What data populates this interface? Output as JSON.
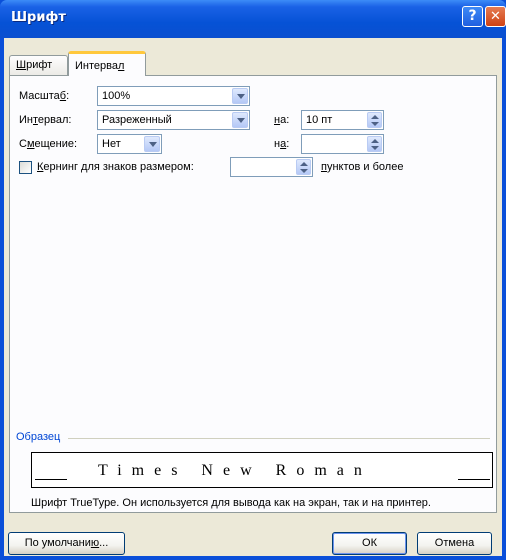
{
  "window": {
    "title": "Шрифт",
    "help_symbol": "?",
    "close_symbol": "✕",
    "icons": {
      "help": "help-icon",
      "close": "close-icon"
    }
  },
  "tabs": [
    {
      "label_u": "Ш",
      "label_rest": "рифт",
      "active": false
    },
    {
      "label_pre": "Интерва",
      "label_u": "л",
      "active": true
    }
  ],
  "spacing": {
    "scale": {
      "label_pre": "Масшта",
      "label_u": "б",
      "label_post": ":",
      "value": "100%"
    },
    "interval": {
      "label_pre": "Ин",
      "label_u": "т",
      "label_post": "ервал:",
      "value": "Разреженный",
      "by_label_u": "н",
      "by_label_post": "а:",
      "by_value": "10 пт"
    },
    "offset": {
      "label_pre": "С",
      "label_u": "м",
      "label_post": "ещение:",
      "value": "Нет",
      "by_label_pre": "н",
      "by_label_u": "а",
      "by_label_post": ":",
      "by_value": ""
    },
    "kerning": {
      "checked": false,
      "label_u": "К",
      "label_rest": "ернинг для знаков размером:",
      "value": "",
      "suffix_u": "п",
      "suffix_rest": "унктов и более"
    }
  },
  "sample": {
    "legend": "Образец",
    "preview_text": "Times New Roman",
    "description": "Шрифт TrueType. Он используется для вывода как на экран, так и на принтер."
  },
  "buttons": {
    "default_pre": "По умолчани",
    "default_u": "ю",
    "default_post": "...",
    "ok": "ОК",
    "cancel": "Отмена"
  },
  "colors": {
    "title_bar": "#0a4fd9",
    "dialog_bg": "#ece9d8",
    "tab_accent": "#ffc83c",
    "legend": "#0046d5"
  }
}
